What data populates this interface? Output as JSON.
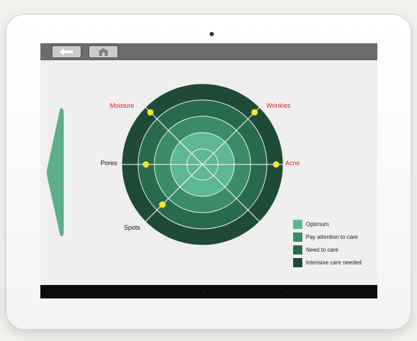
{
  "colors": {
    "optimum": "#5cb892",
    "pay_attention": "#3a8c67",
    "need_care": "#2a6a4c",
    "intensive": "#1f4a36",
    "marker": "#f3e62b",
    "alert": "#e02020"
  },
  "toolbar": {
    "back_icon": "arrow-left-icon",
    "home_icon": "home-icon"
  },
  "radar": {
    "axes": [
      {
        "label": "Moisture",
        "level": 4,
        "alert": true
      },
      {
        "label": "Wrinkles",
        "level": 4,
        "alert": true
      },
      {
        "label": "Acne",
        "level": 4,
        "alert": true
      },
      {
        "label": "Spots",
        "level": 3,
        "alert": false
      },
      {
        "label": "Pores",
        "level": 3,
        "alert": false
      }
    ]
  },
  "legend": [
    {
      "label": "Optimum",
      "color": "#5cb892"
    },
    {
      "label": "Pay attention to care",
      "color": "#3a8c67"
    },
    {
      "label": "Need to care",
      "color": "#2a6a4c"
    },
    {
      "label": "Intensive care needed",
      "color": "#1f4a36"
    }
  ]
}
